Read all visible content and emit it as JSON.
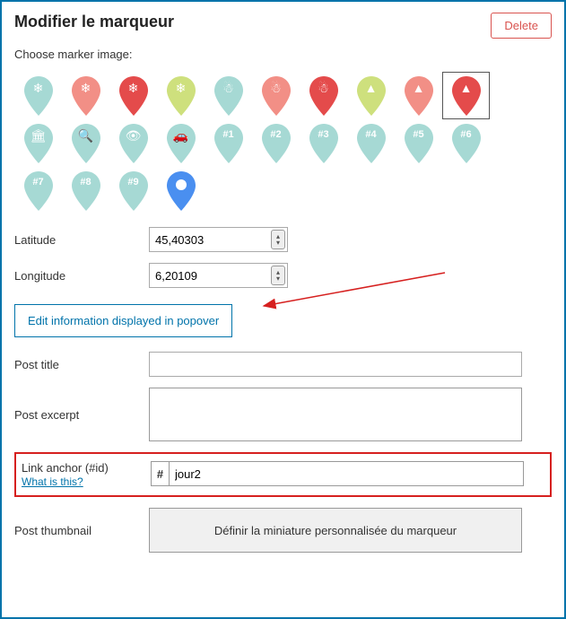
{
  "header": {
    "title": "Modifier le marqueur",
    "delete": "Delete"
  },
  "choose_label": "Choose marker image:",
  "markers": [
    {
      "color": "#a6d9d4",
      "icon": "❄"
    },
    {
      "color": "#f28f86",
      "icon": "❄"
    },
    {
      "color": "#e44b4b",
      "icon": "❄"
    },
    {
      "color": "#cee07d",
      "icon": "❄"
    },
    {
      "color": "#a6d9d4",
      "icon": "☃"
    },
    {
      "color": "#f28f86",
      "icon": "☃"
    },
    {
      "color": "#e44b4b",
      "icon": "☃"
    },
    {
      "color": "#cee07d",
      "icon": "▲"
    },
    {
      "color": "#f28f86",
      "icon": "▲"
    },
    {
      "color": "#e44b4b",
      "icon": "▲",
      "selected": true
    },
    {
      "color": "#a6d9d4",
      "icon": "🏛"
    },
    {
      "color": "#a6d9d4",
      "icon": "🔍"
    },
    {
      "color": "#a6d9d4",
      "icon": "👁"
    },
    {
      "color": "#a6d9d4",
      "icon": "🚗"
    },
    {
      "color": "#a6d9d4",
      "label": "#1"
    },
    {
      "color": "#a6d9d4",
      "label": "#2"
    },
    {
      "color": "#a6d9d4",
      "label": "#3"
    },
    {
      "color": "#a6d9d4",
      "label": "#4"
    },
    {
      "color": "#a6d9d4",
      "label": "#5"
    },
    {
      "color": "#a6d9d4",
      "label": "#6"
    },
    {
      "color": "#a6d9d4",
      "label": "#7"
    },
    {
      "color": "#a6d9d4",
      "label": "#8"
    },
    {
      "color": "#a6d9d4",
      "label": "#9"
    },
    {
      "color": "#4a8ff0",
      "plain": true
    }
  ],
  "coords": {
    "lat_label": "Latitude",
    "lat_value": "45,40303",
    "lng_label": "Longitude",
    "lng_value": "6,20109"
  },
  "accordion": {
    "label": "Edit information displayed in popover"
  },
  "post_title": {
    "label": "Post title",
    "value": ""
  },
  "post_excerpt": {
    "label": "Post excerpt",
    "value": ""
  },
  "link_anchor": {
    "label": "Link anchor (#id)",
    "help": "What is this?",
    "hash": "#",
    "value": "jour2"
  },
  "thumbnail": {
    "label": "Post thumbnail",
    "button": "Définir la miniature personnalisée du marqueur"
  }
}
